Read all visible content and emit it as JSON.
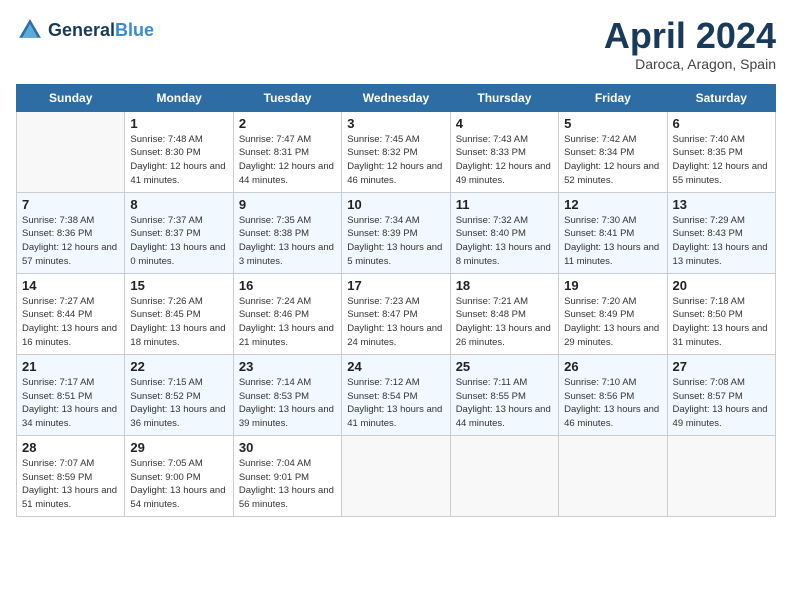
{
  "header": {
    "logo_general": "General",
    "logo_blue": "Blue",
    "month_title": "April 2024",
    "location": "Daroca, Aragon, Spain"
  },
  "weekdays": [
    "Sunday",
    "Monday",
    "Tuesday",
    "Wednesday",
    "Thursday",
    "Friday",
    "Saturday"
  ],
  "weeks": [
    [
      {
        "day": null
      },
      {
        "day": 1,
        "sunrise": "7:48 AM",
        "sunset": "8:30 PM",
        "daylight": "12 hours and 41 minutes."
      },
      {
        "day": 2,
        "sunrise": "7:47 AM",
        "sunset": "8:31 PM",
        "daylight": "12 hours and 44 minutes."
      },
      {
        "day": 3,
        "sunrise": "7:45 AM",
        "sunset": "8:32 PM",
        "daylight": "12 hours and 46 minutes."
      },
      {
        "day": 4,
        "sunrise": "7:43 AM",
        "sunset": "8:33 PM",
        "daylight": "12 hours and 49 minutes."
      },
      {
        "day": 5,
        "sunrise": "7:42 AM",
        "sunset": "8:34 PM",
        "daylight": "12 hours and 52 minutes."
      },
      {
        "day": 6,
        "sunrise": "7:40 AM",
        "sunset": "8:35 PM",
        "daylight": "12 hours and 55 minutes."
      }
    ],
    [
      {
        "day": 7,
        "sunrise": "7:38 AM",
        "sunset": "8:36 PM",
        "daylight": "12 hours and 57 minutes."
      },
      {
        "day": 8,
        "sunrise": "7:37 AM",
        "sunset": "8:37 PM",
        "daylight": "13 hours and 0 minutes."
      },
      {
        "day": 9,
        "sunrise": "7:35 AM",
        "sunset": "8:38 PM",
        "daylight": "13 hours and 3 minutes."
      },
      {
        "day": 10,
        "sunrise": "7:34 AM",
        "sunset": "8:39 PM",
        "daylight": "13 hours and 5 minutes."
      },
      {
        "day": 11,
        "sunrise": "7:32 AM",
        "sunset": "8:40 PM",
        "daylight": "13 hours and 8 minutes."
      },
      {
        "day": 12,
        "sunrise": "7:30 AM",
        "sunset": "8:41 PM",
        "daylight": "13 hours and 11 minutes."
      },
      {
        "day": 13,
        "sunrise": "7:29 AM",
        "sunset": "8:43 PM",
        "daylight": "13 hours and 13 minutes."
      }
    ],
    [
      {
        "day": 14,
        "sunrise": "7:27 AM",
        "sunset": "8:44 PM",
        "daylight": "13 hours and 16 minutes."
      },
      {
        "day": 15,
        "sunrise": "7:26 AM",
        "sunset": "8:45 PM",
        "daylight": "13 hours and 18 minutes."
      },
      {
        "day": 16,
        "sunrise": "7:24 AM",
        "sunset": "8:46 PM",
        "daylight": "13 hours and 21 minutes."
      },
      {
        "day": 17,
        "sunrise": "7:23 AM",
        "sunset": "8:47 PM",
        "daylight": "13 hours and 24 minutes."
      },
      {
        "day": 18,
        "sunrise": "7:21 AM",
        "sunset": "8:48 PM",
        "daylight": "13 hours and 26 minutes."
      },
      {
        "day": 19,
        "sunrise": "7:20 AM",
        "sunset": "8:49 PM",
        "daylight": "13 hours and 29 minutes."
      },
      {
        "day": 20,
        "sunrise": "7:18 AM",
        "sunset": "8:50 PM",
        "daylight": "13 hours and 31 minutes."
      }
    ],
    [
      {
        "day": 21,
        "sunrise": "7:17 AM",
        "sunset": "8:51 PM",
        "daylight": "13 hours and 34 minutes."
      },
      {
        "day": 22,
        "sunrise": "7:15 AM",
        "sunset": "8:52 PM",
        "daylight": "13 hours and 36 minutes."
      },
      {
        "day": 23,
        "sunrise": "7:14 AM",
        "sunset": "8:53 PM",
        "daylight": "13 hours and 39 minutes."
      },
      {
        "day": 24,
        "sunrise": "7:12 AM",
        "sunset": "8:54 PM",
        "daylight": "13 hours and 41 minutes."
      },
      {
        "day": 25,
        "sunrise": "7:11 AM",
        "sunset": "8:55 PM",
        "daylight": "13 hours and 44 minutes."
      },
      {
        "day": 26,
        "sunrise": "7:10 AM",
        "sunset": "8:56 PM",
        "daylight": "13 hours and 46 minutes."
      },
      {
        "day": 27,
        "sunrise": "7:08 AM",
        "sunset": "8:57 PM",
        "daylight": "13 hours and 49 minutes."
      }
    ],
    [
      {
        "day": 28,
        "sunrise": "7:07 AM",
        "sunset": "8:59 PM",
        "daylight": "13 hours and 51 minutes."
      },
      {
        "day": 29,
        "sunrise": "7:05 AM",
        "sunset": "9:00 PM",
        "daylight": "13 hours and 54 minutes."
      },
      {
        "day": 30,
        "sunrise": "7:04 AM",
        "sunset": "9:01 PM",
        "daylight": "13 hours and 56 minutes."
      },
      {
        "day": null
      },
      {
        "day": null
      },
      {
        "day": null
      },
      {
        "day": null
      }
    ]
  ],
  "labels": {
    "sunrise": "Sunrise:",
    "sunset": "Sunset:",
    "daylight": "Daylight:"
  }
}
